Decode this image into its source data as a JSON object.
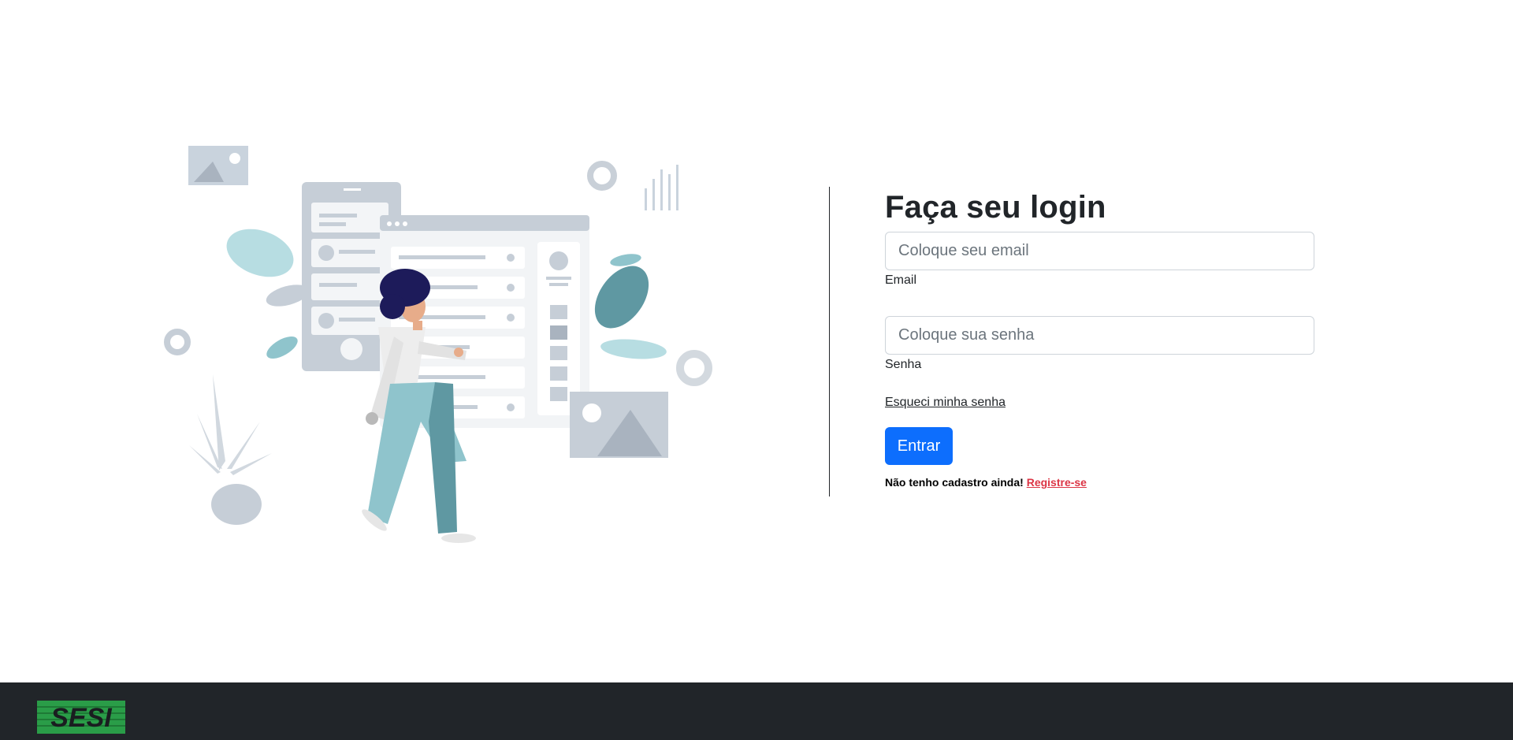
{
  "login": {
    "title": "Faça seu login",
    "email_placeholder": "Coloque seu email",
    "email_label": "Email",
    "password_placeholder": "Coloque sua senha",
    "password_label": "Senha",
    "forgot_link": "Esqueci minha senha",
    "submit_label": "Entrar",
    "no_account_text": "Não tenho cadastro ainda!",
    "register_link": "Registre-se"
  },
  "footer": {
    "logo_text": "SESI",
    "logo_color": "#2a9d48",
    "background": "#212529"
  },
  "colors": {
    "primary": "#0d6efd",
    "danger": "#dc3545"
  }
}
